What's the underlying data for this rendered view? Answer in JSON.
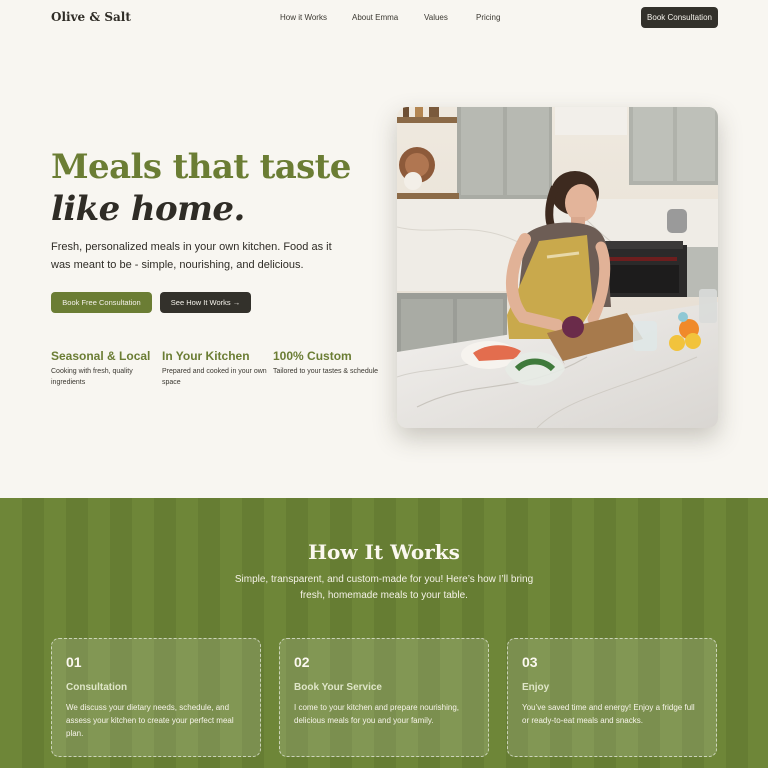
{
  "brand": {
    "name": "Olive & Salt"
  },
  "nav": {
    "links": [
      "How it Works",
      "About Emma",
      "Values",
      "Pricing"
    ],
    "cta": "Book Consultation"
  },
  "hero": {
    "title_line1": "Meals that taste",
    "title_line2": "like home.",
    "subtitle": "Fresh, personalized meals in your own kitchen. Food as it was meant to be - simple, nourishing, and delicious.",
    "primary_button": "Book Free Consultation",
    "secondary_button": "See How It Works →",
    "image_alt": "Woman chopping vegetables in a bright kitchen"
  },
  "features": [
    {
      "title": "Seasonal & Local",
      "desc": "Cooking with fresh, quality ingredients"
    },
    {
      "title": "In Your Kitchen",
      "desc": "Prepared and cooked in your own space"
    },
    {
      "title": "100% Custom",
      "desc": "Tailored to your tastes & schedule"
    }
  ],
  "how_it_works": {
    "title": "How It Works",
    "subtitle": "Simple, transparent, and custom-made for you! Here’s how I’ll bring fresh, homemade meals to your table.",
    "steps": [
      {
        "num": "01",
        "title": "Consultation",
        "desc": "We discuss your dietary needs, schedule, and assess your kitchen to create your perfect meal plan."
      },
      {
        "num": "02",
        "title": "Book Your Service",
        "desc": "I come to your kitchen and prepare nourishing, delicious meals for you and your family."
      },
      {
        "num": "03",
        "title": "Enjoy",
        "desc": "You’ve saved time and energy! Enjoy a fridge full or ready-to-eat meals and snacks."
      }
    ]
  },
  "colors": {
    "olive": "#6b7d34",
    "dark": "#33312b",
    "cream": "#f8f6f1"
  }
}
